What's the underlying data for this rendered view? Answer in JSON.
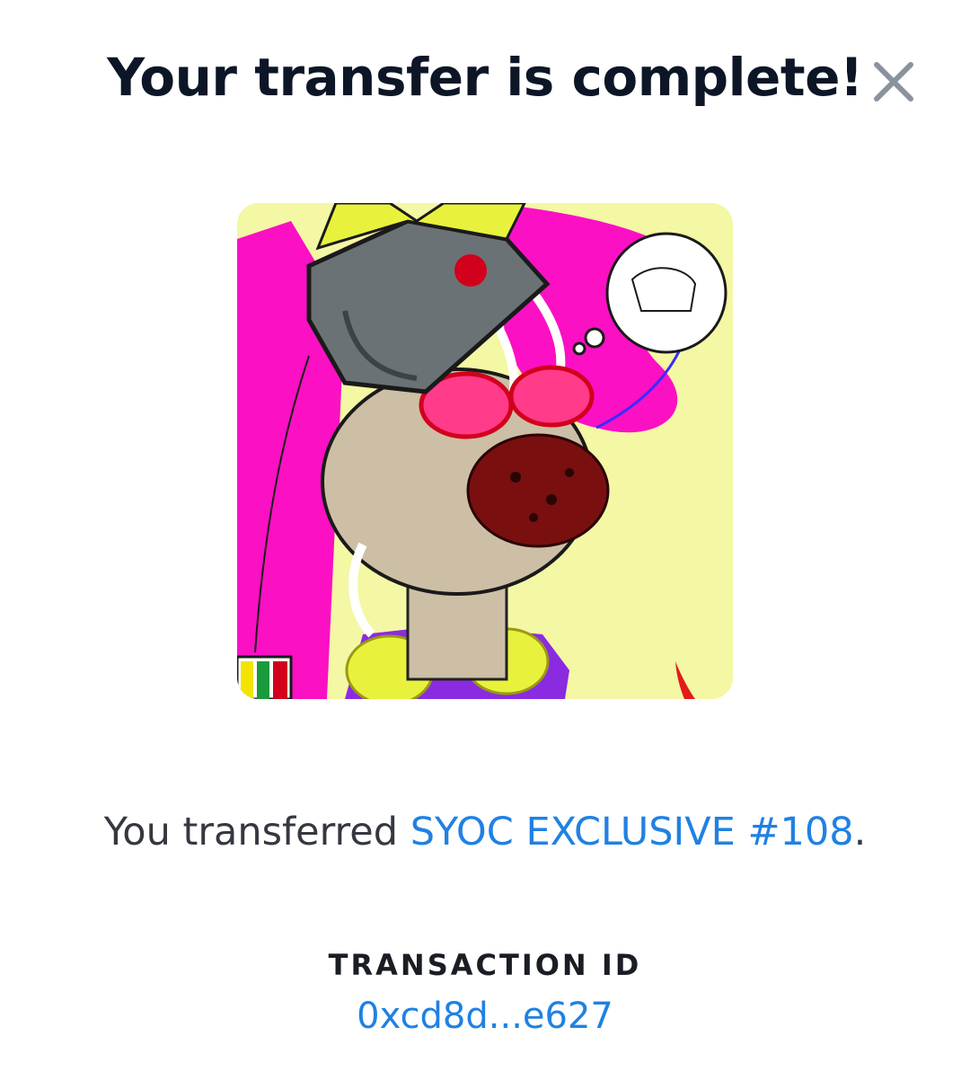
{
  "modal": {
    "title": "Your transfer is complete!",
    "close_icon": "close-icon",
    "image_alt": "SYOC EXCLUSIVE #108"
  },
  "message": {
    "prefix": "You transferred ",
    "item_name": "SYOC EXCLUSIVE #108",
    "suffix": "."
  },
  "transaction": {
    "label": "TRANSACTION ID",
    "id": "0xcd8d...e627"
  },
  "colors": {
    "title": "#0c1626",
    "link": "#2081e2",
    "body_text": "#353840",
    "close_icon": "#8a939b"
  }
}
